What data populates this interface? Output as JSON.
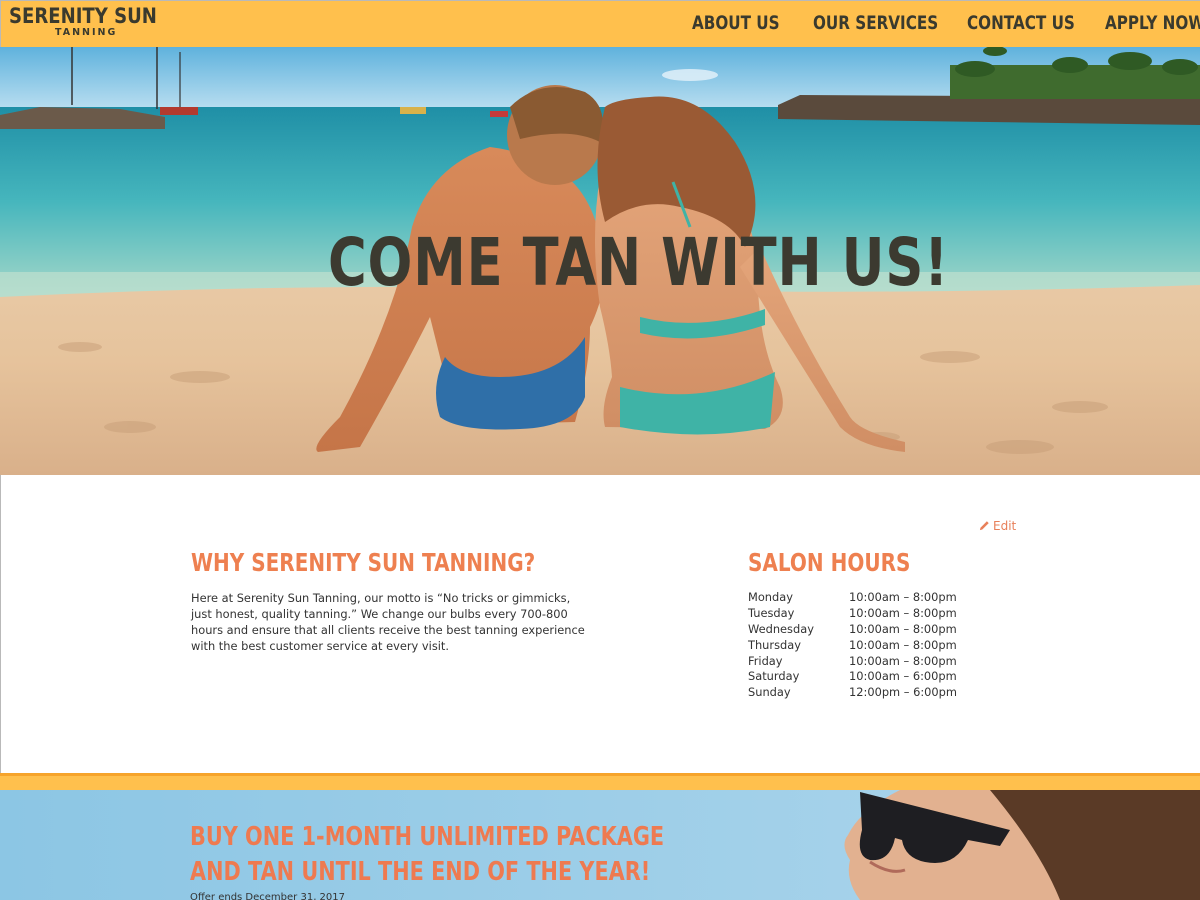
{
  "header": {
    "logo_main": "SERENITY SUN",
    "logo_sub": "TANNING",
    "nav": [
      {
        "label": "ABOUT US"
      },
      {
        "label": "OUR SERVICES"
      },
      {
        "label": "CONTACT US"
      },
      {
        "label": "APPLY NOW!"
      }
    ]
  },
  "hero": {
    "title": "COME TAN WITH US!"
  },
  "edit": {
    "label": "Edit",
    "icon": "pencil-icon"
  },
  "why": {
    "title": "WHY SERENITY SUN TANNING?",
    "body": "Here at Serenity Sun Tanning, our motto is “No tricks or gimmicks, just honest, quality tanning.”  We change our bulbs every 700-800 hours and ensure that all clients receive the best tanning experience with the best customer service at every visit."
  },
  "hours": {
    "title": "SALON HOURS",
    "rows": [
      {
        "day": "Monday",
        "time": "10:00am – 8:00pm"
      },
      {
        "day": "Tuesday",
        "time": "10:00am – 8:00pm"
      },
      {
        "day": "Wednesday",
        "time": "10:00am – 8:00pm"
      },
      {
        "day": "Thursday",
        "time": "10:00am – 8:00pm"
      },
      {
        "day": "Friday",
        "time": "10:00am – 8:00pm"
      },
      {
        "day": "Saturday",
        "time": "10:00am – 6:00pm"
      },
      {
        "day": "Sunday",
        "time": "12:00pm – 6:00pm"
      }
    ]
  },
  "promo": {
    "line1": "BUY ONE 1-MONTH UNLIMITED PACKAGE",
    "line2": "AND TAN UNTIL THE END OF THE YEAR!",
    "fine_print": "Offer ends December 31, 2017"
  },
  "colors": {
    "header_bg": "#ffc04d",
    "accent_orange": "#ee8050",
    "dark_text": "#3a3a2e"
  }
}
